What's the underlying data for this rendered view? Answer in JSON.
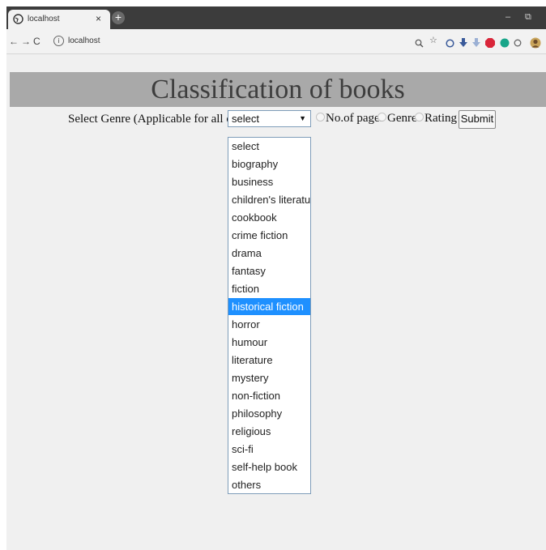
{
  "browser": {
    "tab_title": "localhost",
    "tab_close": "×",
    "new_tab": "+",
    "url": "localhost",
    "nav": {
      "back": "←",
      "forward": "→",
      "reload": "C"
    },
    "window_controls": {
      "minimize": "–",
      "restore": "⧉"
    }
  },
  "page": {
    "title": "Classification of books",
    "form": {
      "genre_label": "Select Genre (Applicable for all options)",
      "select_value": "select",
      "radios": [
        {
          "label": "No.of pages"
        },
        {
          "label": "Genre"
        },
        {
          "label": "Rating"
        }
      ],
      "submit_label": "Submit"
    },
    "dropdown": {
      "highlighted_index": 9,
      "options": [
        "select",
        "biography",
        "business",
        "children's literature",
        "cookbook",
        "crime fiction",
        "drama",
        "fantasy",
        "fiction",
        "historical fiction",
        "horror",
        "humour",
        "literature",
        "mystery",
        "non-fiction",
        "philosophy",
        "religious",
        "sci-fi",
        "self-help book",
        "others"
      ]
    }
  },
  "colors": {
    "banner": "#a9a9a9",
    "highlight": "#1e90ff",
    "page_bg": "#f0f0f0"
  }
}
